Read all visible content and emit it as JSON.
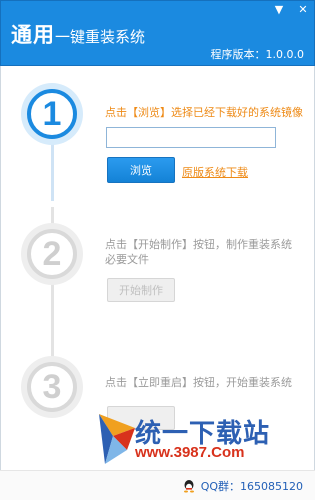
{
  "header": {
    "title_main": "通用",
    "title_sub": "一键重装系统",
    "version_label": "程序版本：1.0.0.0",
    "controls": [
      "▼",
      "✕"
    ]
  },
  "steps": [
    {
      "number": "1",
      "text": "点击【浏览】选择已经下载好的系统镜像"
    },
    {
      "number": "2",
      "text": "点击【开始制作】按钮，制作重装系统必要文件"
    },
    {
      "number": "3",
      "text": "点击【立即重启】按钮，开始重装系统"
    }
  ],
  "input": {
    "value": "",
    "placeholder": ""
  },
  "buttons": {
    "browse": "浏览",
    "download_link": "原版系统下载",
    "start_make": "开始制作",
    "restart_now": ""
  },
  "watermark": {
    "name": "统一下载站",
    "url": "www.3987.Com"
  },
  "footer": {
    "qq_text": "QQ群：165085120"
  },
  "colors": {
    "accent": "#1b8ae0",
    "highlight": "#ee8a16",
    "disabled": "#cfcfcf"
  },
  "icons": [
    "chevron-down-icon",
    "close-icon",
    "qq-penguin-icon"
  ]
}
